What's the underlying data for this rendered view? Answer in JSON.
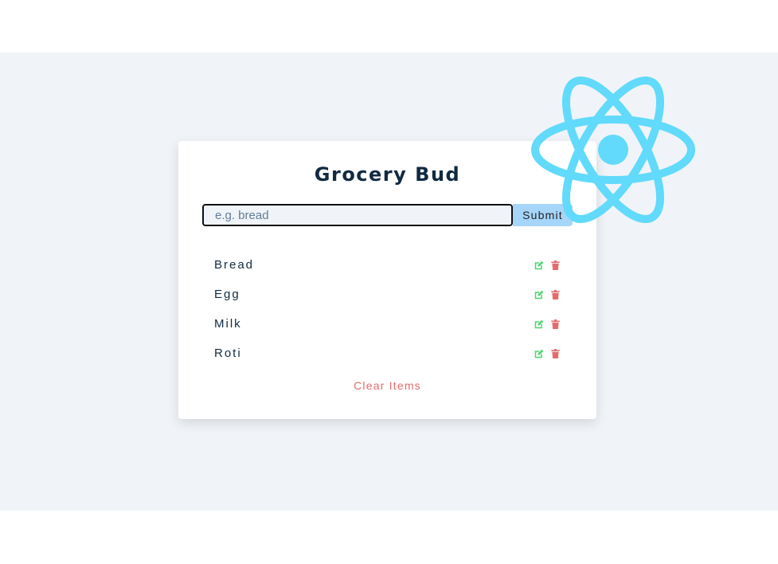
{
  "app": {
    "title": "Grocery Bud"
  },
  "form": {
    "input_value": "",
    "placeholder": "e.g. bread",
    "submit_label": "Submit"
  },
  "items": [
    {
      "name": "Bread"
    },
    {
      "name": "Egg"
    },
    {
      "name": "Milk"
    },
    {
      "name": "Roti"
    }
  ],
  "icons": {
    "edit": "edit-icon",
    "delete": "trash-icon",
    "logo": "react-logo"
  },
  "clear_label": "Clear Items",
  "colors": {
    "background": "#f0f4f8",
    "title": "#102a42",
    "submit_bg": "#a5d5f8",
    "edit": "#4ad66d",
    "delete": "#e66b6b",
    "react": "#61dafb"
  }
}
